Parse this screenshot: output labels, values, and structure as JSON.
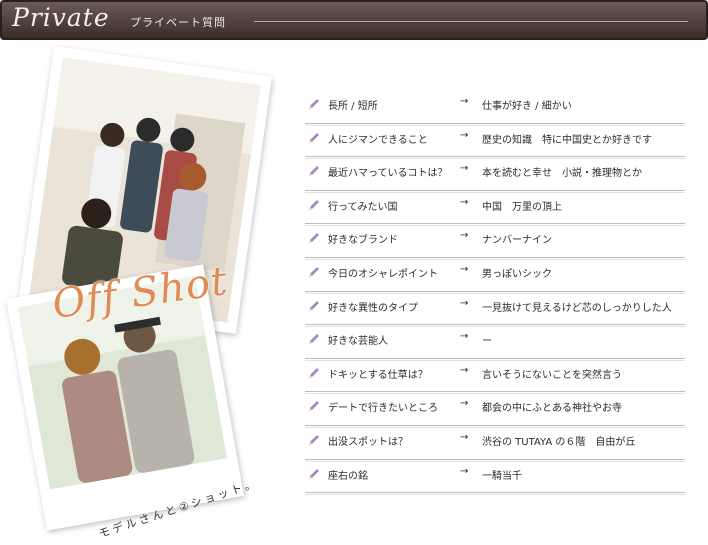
{
  "header": {
    "title": "Private",
    "subtitle": "プライベート質問"
  },
  "photos": {
    "overlay_text": "Off Shot",
    "caption": "モデルさんと②ショット。"
  },
  "qa": [
    {
      "q": "長所 / 短所",
      "a": "仕事が好き / 細かい"
    },
    {
      "q": "人にジマンできること",
      "a": "歴史の知識　特に中国史とか好きです"
    },
    {
      "q": "最近ハマっているコトは？",
      "a": "本を読むと幸せ　小説・推理物とか"
    },
    {
      "q": "行ってみたい国",
      "a": "中国　万里の頂上"
    },
    {
      "q": "好きなブランド",
      "a": "ナンバーナイン"
    },
    {
      "q": "今日のオシャレポイント",
      "a": "男っぽいシック"
    },
    {
      "q": "好きな異性のタイプ",
      "a": "一見抜けて見えるけど芯のしっかりした人"
    },
    {
      "q": "好きな芸能人",
      "a": "ー"
    },
    {
      "q": "ドキッとする仕草は？",
      "a": "言いそうにないことを突然言う"
    },
    {
      "q": "デートで行きたいところ",
      "a": "都会の中にふとある神社やお寺"
    },
    {
      "q": "出没スポットは？",
      "a": "渋谷の TUTAYA の６階　自由が丘"
    },
    {
      "q": "座右の銘",
      "a": "一騎当千"
    }
  ],
  "arrow": "→",
  "colors": {
    "header_bg": "#4a3a36",
    "accent": "#e08a55",
    "pencil": "#a58bc6"
  }
}
